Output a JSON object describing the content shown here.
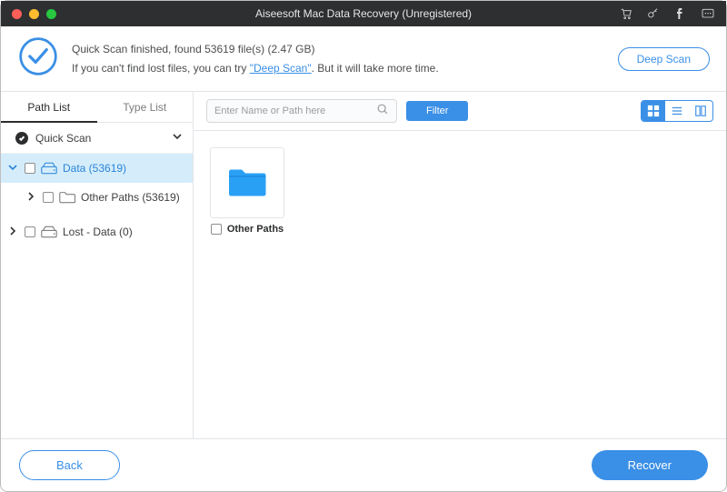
{
  "titlebar": {
    "title": "Aiseesoft Mac Data Recovery (Unregistered)"
  },
  "banner": {
    "line1_prefix": "Quick Scan finished, found ",
    "file_count": "53619",
    "line1_mid": " file(s) (",
    "total_size": "2.47 GB",
    "line1_suffix": ")",
    "line2_prefix": "If you can't find lost files, you can try ",
    "deep_scan_link": "\"Deep Scan\"",
    "line2_suffix": ". But it will take more time.",
    "deep_scan_button": "Deep Scan"
  },
  "sidebar": {
    "tabs": {
      "path": "Path List",
      "type": "Type List"
    },
    "quick_scan": "Quick Scan",
    "tree": {
      "data": "Data (53619)",
      "other_paths": "Other Paths (53619)",
      "lost_data": "Lost - Data (0)"
    }
  },
  "toolbar": {
    "search_placeholder": "Enter Name or Path here",
    "filter": "Filter"
  },
  "grid": {
    "item0": "Other Paths"
  },
  "footer": {
    "back": "Back",
    "recover": "Recover"
  }
}
